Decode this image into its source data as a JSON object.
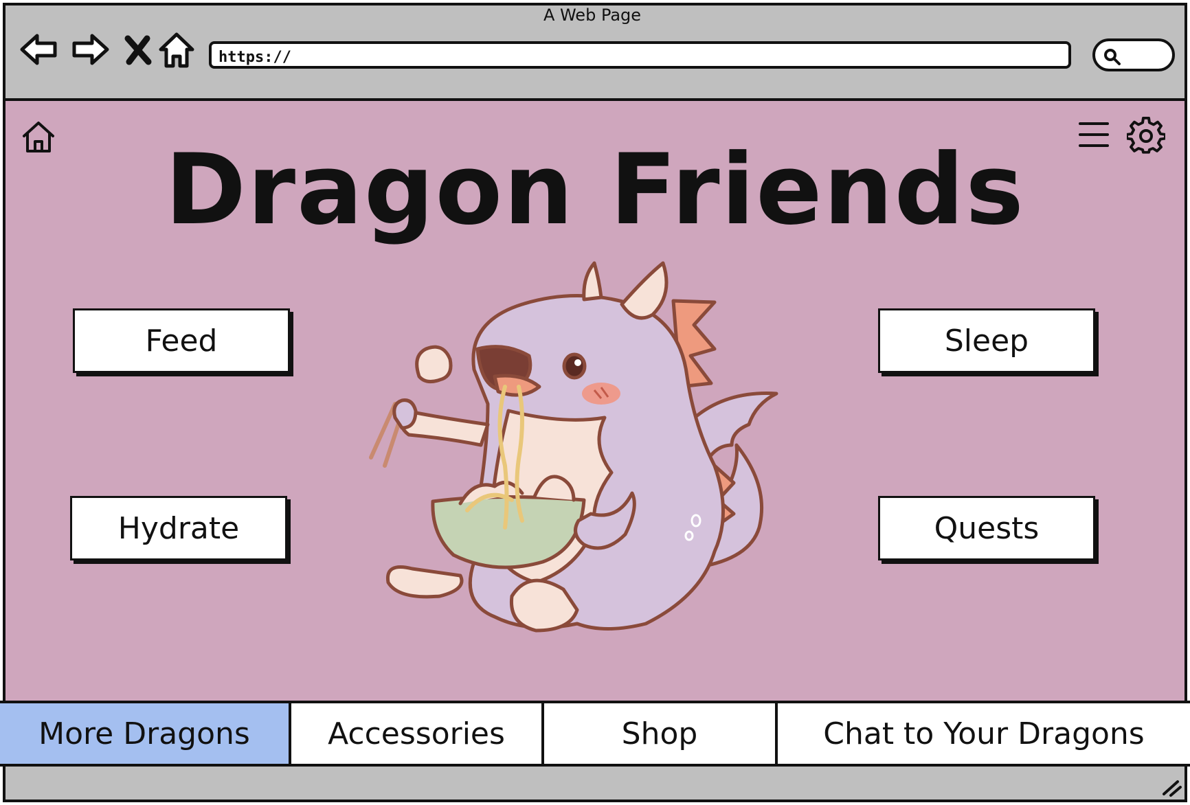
{
  "browser": {
    "title": "A Web Page",
    "url": "https://",
    "nav_icons": [
      "back-arrow-icon",
      "forward-arrow-icon",
      "close-x-icon",
      "home-icon"
    ],
    "search_icon": "magnifier-icon"
  },
  "page": {
    "title": "Dragon Friends",
    "background_color": "#cfa6bd",
    "header_icons": {
      "left": "home-outline-icon",
      "right": [
        "hamburger-menu-icon",
        "gear-icon"
      ]
    }
  },
  "actions": {
    "feed": "Feed",
    "hydrate": "Hydrate",
    "sleep": "Sleep",
    "quests": "Quests"
  },
  "tabs": {
    "items": [
      {
        "label": "More Dragons",
        "active": true
      },
      {
        "label": "Accessories",
        "active": false
      },
      {
        "label": "Shop",
        "active": false
      },
      {
        "label": "Chat to Your Dragons",
        "active": false
      }
    ],
    "active_color": "#a4bff0"
  }
}
